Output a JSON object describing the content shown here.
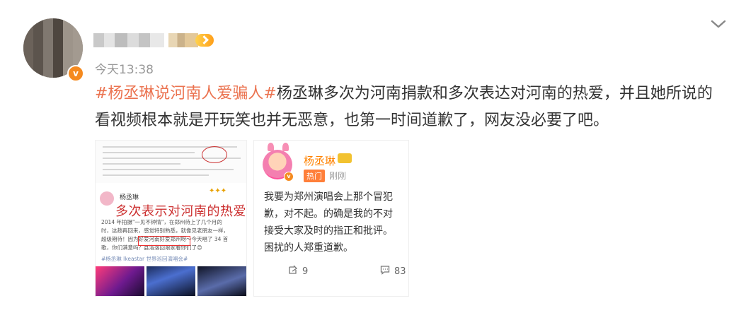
{
  "post": {
    "timestamp": "今天13:38",
    "topic": "#杨丞琳说河南人爱骗人#",
    "text": "杨丞琳多次为河南捐款和多次表达对河南的热爱，并且她所说的看视频根本就是开玩笑也并无恶意，也第一时间道歉了，网友没必要了吧。"
  },
  "icons": {
    "menu": "chevron-down-icon",
    "verified": "verified-badge-icon",
    "vip": "vip-badge-icon",
    "repost": "repost-icon",
    "comment": "comment-icon"
  },
  "colors": {
    "topic": "#eb7350",
    "timestamp": "#999999",
    "verified": "#f58a1f"
  },
  "image_a": {
    "author": "杨丞琳",
    "headline": "多次表示对河南的热爱",
    "body_lines": [
      "2014 年拍摄\"一见不钟情\"，在郑州待上了几个月的",
      "时，这趟再回来，感觉特别熟悉，就像见老朋友一样，",
      "超级期待！因为好爱河南好爱郑州呀～今天唱了 34 首",
      "歌，你们满意吗？县洛落回艰家看你们了😍"
    ],
    "hashtags": "#杨丞琳 lkeastar 世界巡回演唱会#"
  },
  "image_b": {
    "author": "杨丞琳",
    "hot_label": "热门",
    "time": "刚刚",
    "body_lines": [
      "我要为郑州演唱会上那个冒犯",
      "歉，对不起。的确是我的不对",
      "接受大家及时的指正和批评。",
      "困扰的人郑重道歉。"
    ],
    "reposts": "9",
    "comments": "83"
  }
}
